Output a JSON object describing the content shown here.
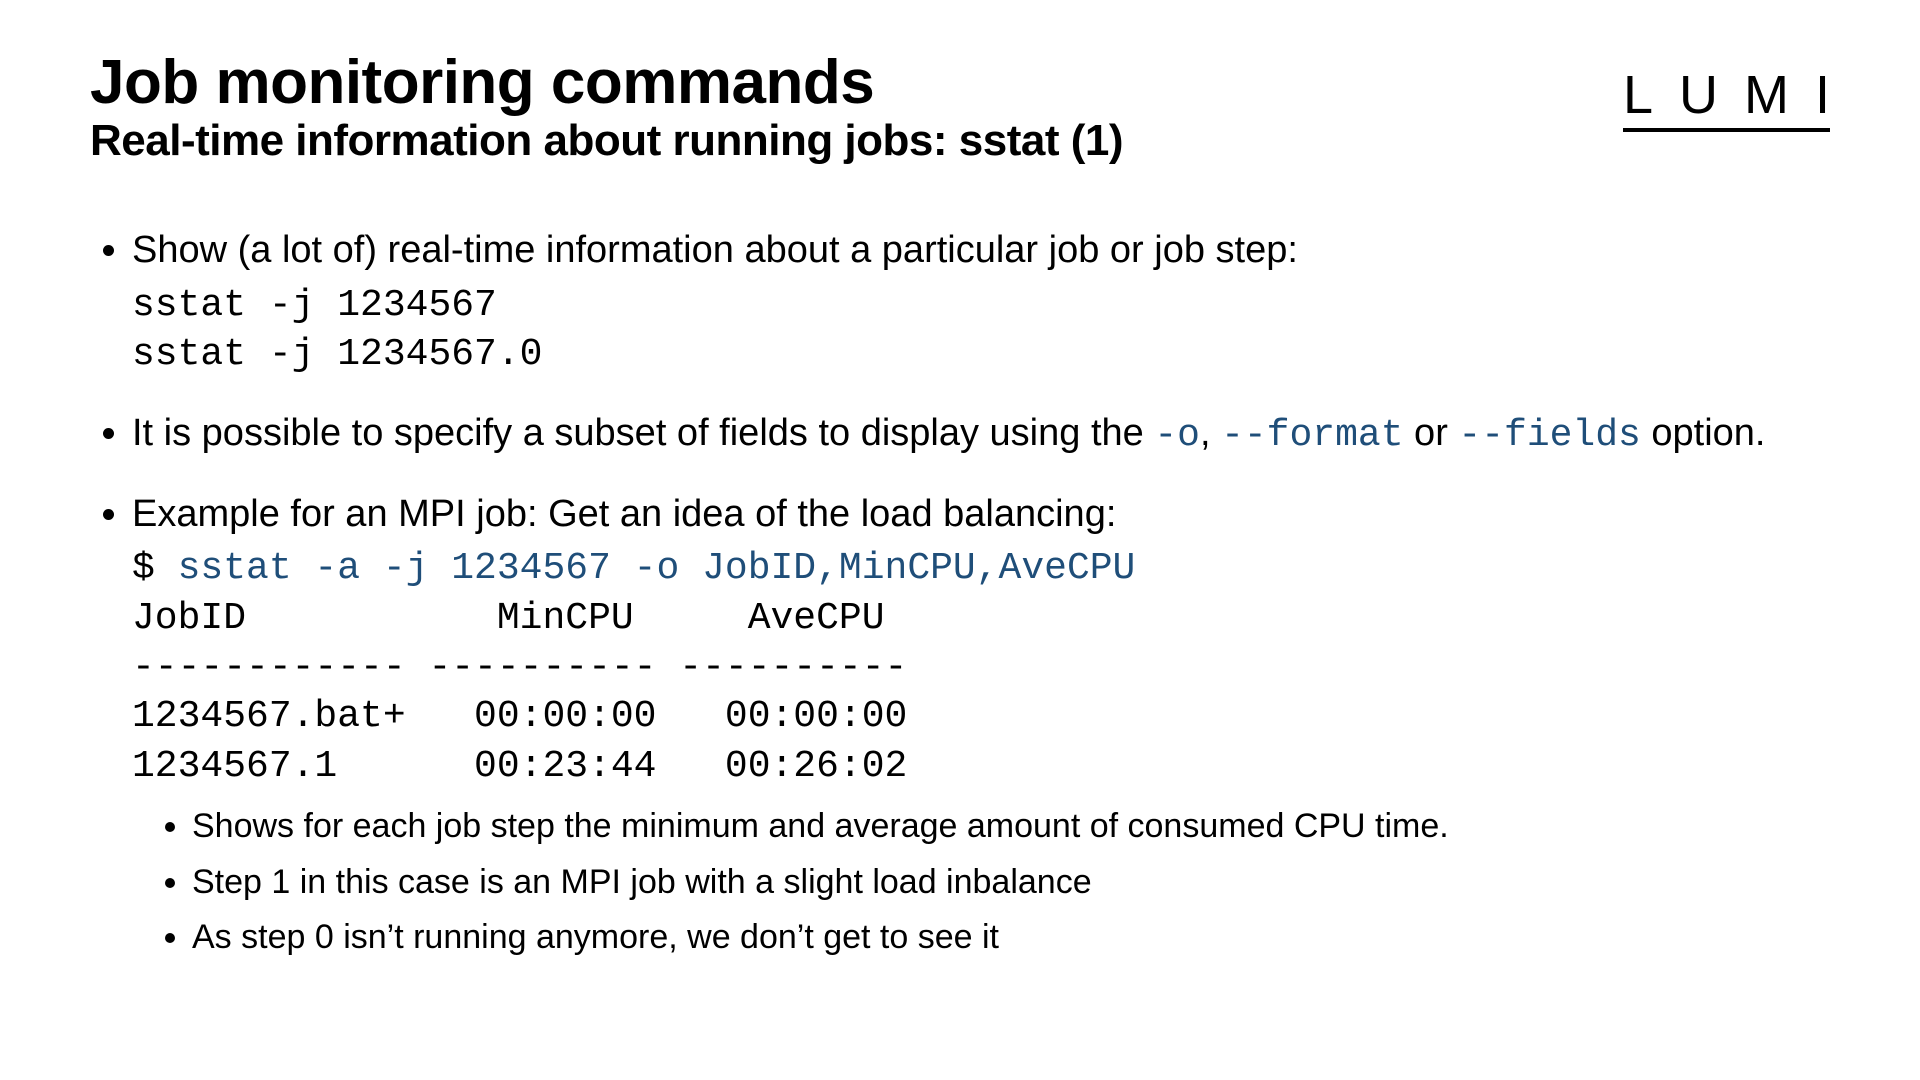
{
  "header": {
    "title": "Job monitoring commands",
    "subtitle": "Real-time information about running jobs: sstat (1)",
    "logo_letters": [
      "L",
      "U",
      "M",
      "I"
    ]
  },
  "bullets": {
    "b1_text": "Show (a lot of) real-time information about a particular job or job step:",
    "b1_code_line1": "sstat -j 1234567",
    "b1_code_line2": "sstat -j 1234567.0",
    "b2_pre": "It is possible to specify a subset of fields to display using the ",
    "b2_opt1": "-o",
    "b2_sep1": ", ",
    "b2_opt2": "--format",
    "b2_sep2": " or ",
    "b2_opt3": "--fields",
    "b2_post": " option.",
    "b3_text": "Example for an MPI job: Get an idea of the load balancing:",
    "b3_prompt": "$ ",
    "b3_cmd": "sstat -a -j 1234567 -o JobID,MinCPU,AveCPU",
    "b3_out_header": "JobID           MinCPU     AveCPU",
    "b3_out_sep": "------------ ---------- ----------",
    "b3_out_row1": "1234567.bat+   00:00:00   00:00:00",
    "b3_out_row2": "1234567.1      00:23:44   00:26:02",
    "sub1": "Shows for each job step the minimum and average amount of consumed CPU time.",
    "sub2": "Step 1 in this case is an MPI job with a slight load inbalance",
    "sub3": "As step 0 isn’t running anymore, we don’t get to see it"
  }
}
